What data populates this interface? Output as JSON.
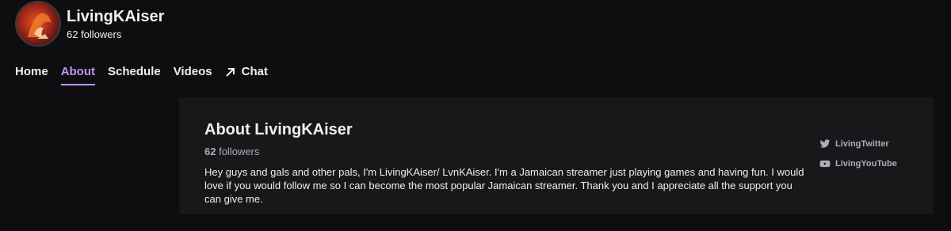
{
  "channel": {
    "name": "LivingKAiser",
    "followers_label": "62 followers"
  },
  "nav": {
    "items": [
      {
        "label": "Home"
      },
      {
        "label": "About"
      },
      {
        "label": "Schedule"
      },
      {
        "label": "Videos"
      },
      {
        "label": "Chat"
      }
    ],
    "active": "About"
  },
  "about": {
    "title": "About LivingKAiser",
    "followers_count": "62",
    "followers_word": "followers",
    "bio": "Hey guys and gals and other pals, I'm LivingKAiser/ LvnKAiser. I'm a Jamaican streamer just playing games and having fun. I would love if you would follow me so I can become the most popular Jamaican streamer. Thank you and I appreciate all the support you can give me."
  },
  "social": [
    {
      "label": "LivingTwitter",
      "icon": "twitter-icon"
    },
    {
      "label": "LivingYouTube",
      "icon": "youtube-icon"
    }
  ],
  "colors": {
    "background": "#0e0e10",
    "panel": "#18181b",
    "accent": "#bf94ff",
    "text": "#efeff1",
    "muted": "#adadb8"
  }
}
